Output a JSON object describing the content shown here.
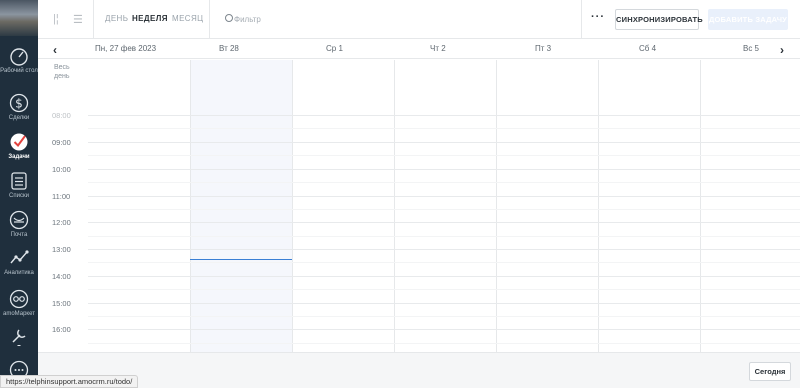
{
  "colors": {
    "sidebar_bg": "#1f2f3d",
    "accent": "#3a7fd5",
    "today_column": "#f5f7fc",
    "add_button_bg": "#e9f0fb"
  },
  "sidebar": {
    "items": [
      {
        "label": "Рабочий стол",
        "icon": "speedometer-icon"
      },
      {
        "label": "Сделки",
        "icon": "dollar-icon"
      },
      {
        "label": "Задачи",
        "icon": "check-circle-icon",
        "active": true
      },
      {
        "label": "Списки",
        "icon": "list-icon"
      },
      {
        "label": "Почта",
        "icon": "mail-icon"
      },
      {
        "label": "Аналитика",
        "icon": "chart-icon"
      },
      {
        "label": "amoМаркет",
        "icon": "market-icon"
      },
      {
        "label": "",
        "icon": "settings-icon"
      }
    ]
  },
  "header": {
    "view_tabs": [
      {
        "label": "ДЕНЬ",
        "active": false
      },
      {
        "label": "НЕДЕЛЯ",
        "active": true
      },
      {
        "label": "МЕСЯЦ",
        "active": false
      }
    ],
    "search_placeholder": "Фильтр",
    "more_label": "···",
    "sync_label": "СИНХРОНИЗИРОВАТЬ",
    "add_task_label": "ДОБАВИТЬ ЗАДАЧУ"
  },
  "calendar": {
    "days": [
      "Пн, 27 фев 2023",
      "Вт 28",
      "Ср 1",
      "Чт 2",
      "Пт 3",
      "Сб 4",
      "Вс 5"
    ],
    "all_day_label": "Весь день",
    "hours": [
      "08:00",
      "09:00",
      "10:00",
      "11:00",
      "12:00",
      "13:00",
      "14:00",
      "15:00",
      "16:00"
    ],
    "today_index": 1
  },
  "footer": {
    "today_label": "Сегодня"
  },
  "status_url": "https://telphinsupport.amocrm.ru/todo/"
}
